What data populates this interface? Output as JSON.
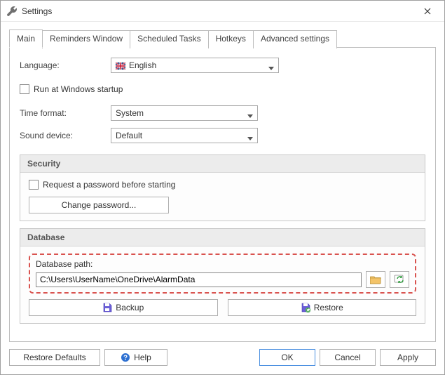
{
  "window": {
    "title": "Settings"
  },
  "tabs": [
    "Main",
    "Reminders Window",
    "Scheduled Tasks",
    "Hotkeys",
    "Advanced settings"
  ],
  "main": {
    "language_label": "Language:",
    "language_value": "English",
    "run_at_startup_label": "Run at Windows startup",
    "time_format_label": "Time format:",
    "time_format_value": "System",
    "sound_device_label": "Sound device:",
    "sound_device_value": "Default"
  },
  "security": {
    "header": "Security",
    "request_password_label": "Request a password before starting",
    "change_password_label": "Change password..."
  },
  "database": {
    "header": "Database",
    "path_label": "Database path:",
    "path_value": "C:\\Users\\UserName\\OneDrive\\AlarmData",
    "backup_label": "Backup",
    "restore_label": "Restore"
  },
  "footer": {
    "restore_defaults": "Restore Defaults",
    "help": "Help",
    "ok": "OK",
    "cancel": "Cancel",
    "apply": "Apply"
  }
}
